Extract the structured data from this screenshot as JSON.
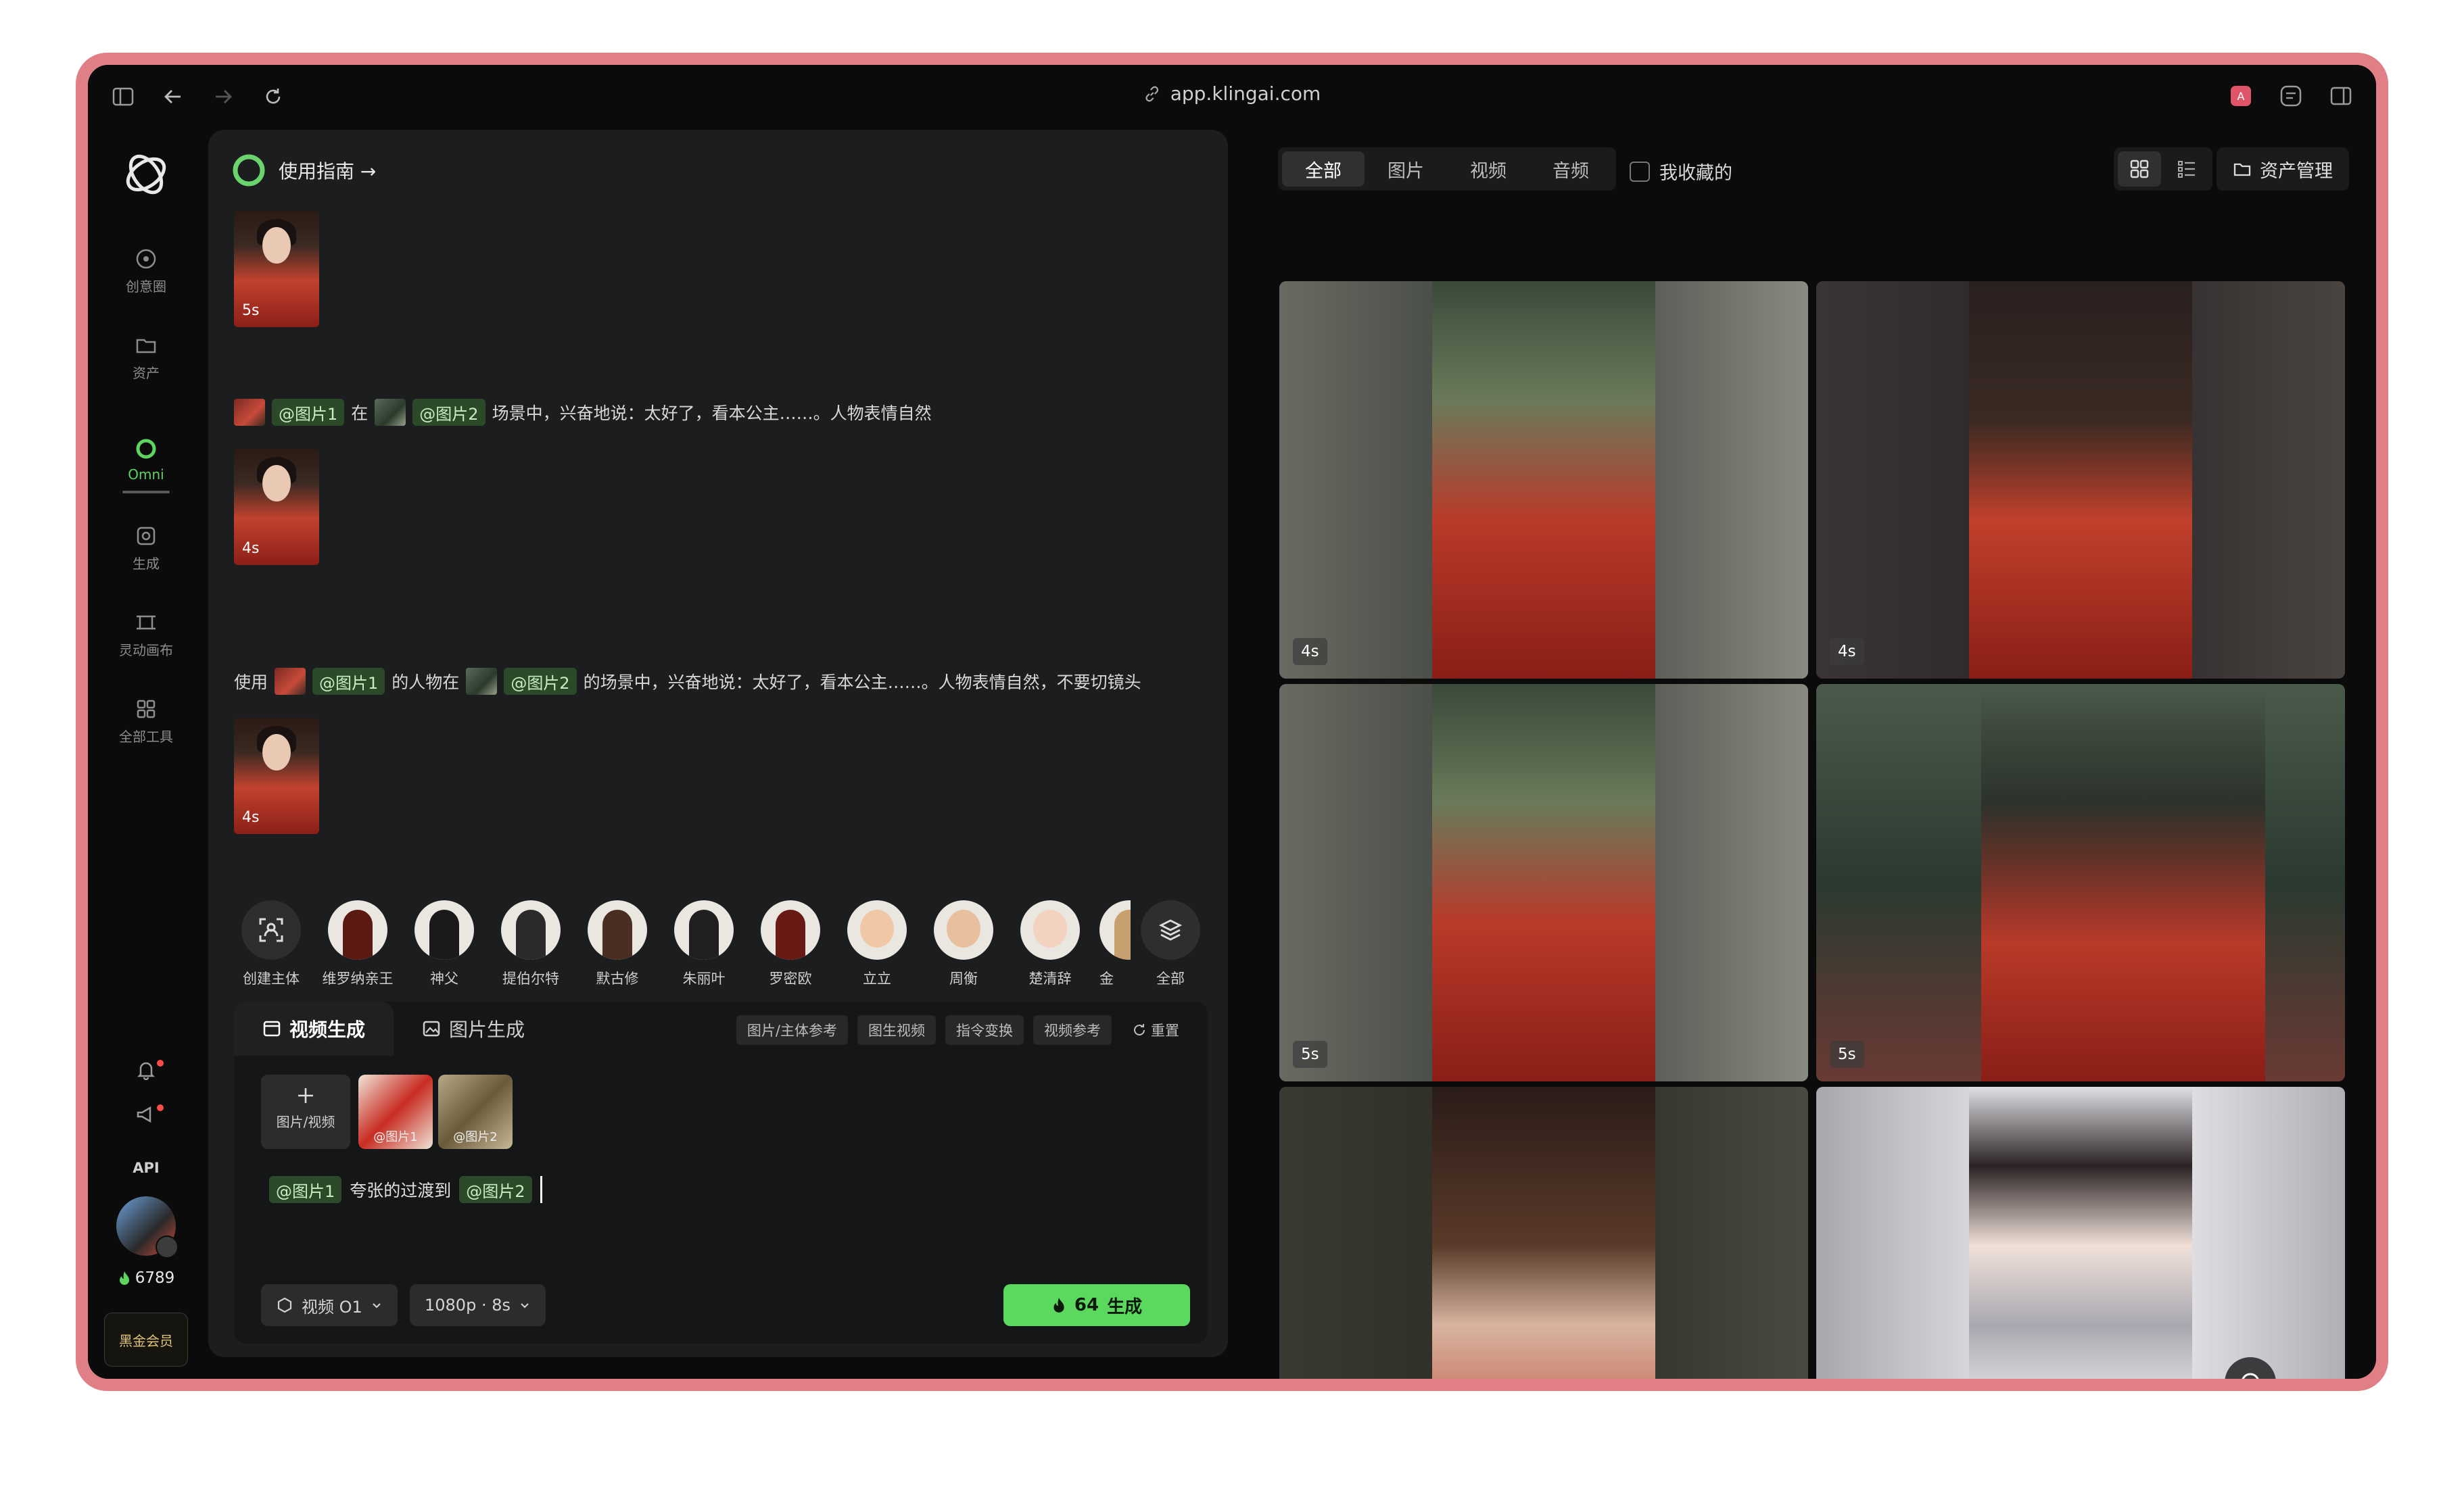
{
  "browser": {
    "url": "app.klingai.com"
  },
  "rail": {
    "items": [
      {
        "label": "创意圈"
      },
      {
        "label": "资产"
      },
      {
        "label": "Omni"
      },
      {
        "label": "生成"
      },
      {
        "label": "灵动画布"
      },
      {
        "label": "全部工具"
      }
    ],
    "api_label": "API",
    "credits": "6789",
    "vip_label": "黑金会员",
    "more": "···"
  },
  "chat": {
    "guide": "使用指南 →",
    "messages": [
      {
        "duration": "5s"
      },
      {
        "chip1": "@图片1",
        "mid": "在",
        "chip2": "@图片2",
        "tail": "场景中，兴奋地说：太好了，看本公主……。人物表情自然",
        "duration": "4s"
      },
      {
        "prefix": "使用",
        "chip1": "@图片1",
        "mid": "的人物在",
        "chip2": "@图片2",
        "tail": "的场景中，兴奋地说：太好了，看本公主……。人物表情自然，不要切镜头",
        "duration": "4s"
      }
    ]
  },
  "subjects": {
    "items": [
      "创建主体",
      "维罗纳亲王",
      "神父",
      "提伯尔特",
      "默古修",
      "朱丽叶",
      "罗密欧",
      "立立",
      "周衡",
      "楚清辞",
      "金"
    ],
    "all_label": "全部"
  },
  "composer": {
    "tab_video": "视频生成",
    "tab_image": "图片生成",
    "tools": [
      "图片/主体参考",
      "图生视频",
      "指令变换",
      "视频参考"
    ],
    "reset": "重置",
    "upload_label": "图片/视频",
    "refs": [
      "@图片1",
      "@图片2"
    ],
    "input": {
      "chip1": "@图片1",
      "text": "夸张的过渡到",
      "chip2": "@图片2"
    },
    "model": "视频 O1",
    "quality": "1080p · 8s",
    "cost": "64",
    "generate": "生成"
  },
  "gallery": {
    "filters": [
      "全部",
      "图片",
      "视频",
      "音频"
    ],
    "favorites": "我收藏的",
    "asset_mgmt": "资产管理",
    "cards": [
      {
        "duration": "4s"
      },
      {
        "duration": "4s"
      },
      {
        "duration": "5s"
      },
      {
        "duration": "5s"
      },
      {
        "duration": ""
      },
      {
        "duration": ""
      }
    ]
  }
}
